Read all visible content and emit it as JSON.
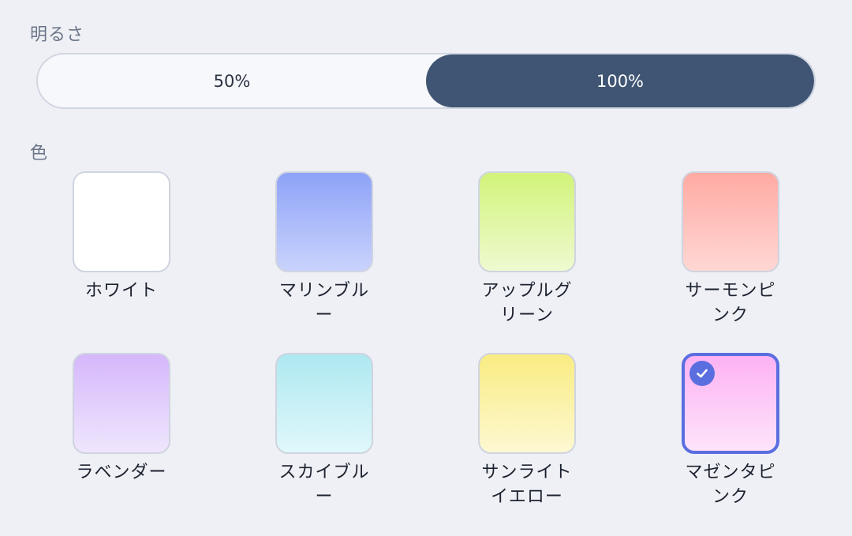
{
  "brightness": {
    "label": "明るさ",
    "options": [
      "50%",
      "100%"
    ],
    "selected": "100%"
  },
  "color": {
    "label": "色",
    "selected": "マゼンタピンク",
    "swatches": [
      {
        "name": "ホワイト",
        "top": "#ffffff",
        "bottom": "#ffffff"
      },
      {
        "name": "マリンブルー",
        "top": "#8ea2f8",
        "bottom": "#c9d3fc"
      },
      {
        "name": "アップルグリーン",
        "top": "#d2f37a",
        "bottom": "#eefad0"
      },
      {
        "name": "サーモンピンク",
        "top": "#ffaaa3",
        "bottom": "#ffd7d4"
      },
      {
        "name": "ラベンダー",
        "top": "#d5b7fb",
        "bottom": "#efe6fd"
      },
      {
        "name": "スカイブルー",
        "top": "#aee8f0",
        "bottom": "#e0f8fb"
      },
      {
        "name": "サンライトイエロー",
        "top": "#f9ec82",
        "bottom": "#fdf8d2"
      },
      {
        "name": "マゼンタピンク",
        "top": "#fdb2f3",
        "bottom": "#fde4fb"
      }
    ]
  }
}
